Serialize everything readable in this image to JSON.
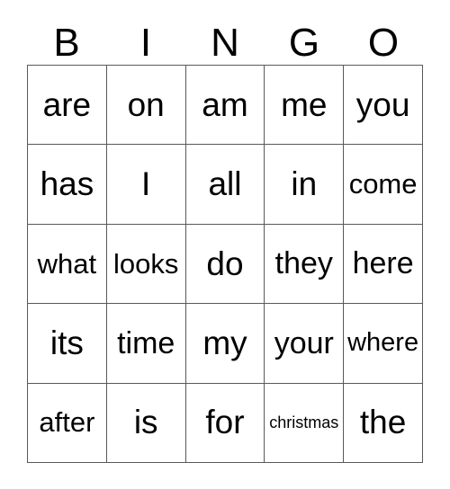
{
  "card": {
    "type": "bingo-card",
    "columns": 5,
    "rows": 5,
    "background_color": "#ffffff",
    "text_color": "#000000",
    "border_color": "#595959"
  },
  "header": {
    "letters": [
      {
        "label": "B"
      },
      {
        "label": "I"
      },
      {
        "label": "N"
      },
      {
        "label": "G"
      },
      {
        "label": "O"
      }
    ]
  },
  "grid": {
    "rows": [
      {
        "cells": [
          {
            "word": "are",
            "size": "fs-xl"
          },
          {
            "word": "on",
            "size": "fs-xl"
          },
          {
            "word": "am",
            "size": "fs-xl"
          },
          {
            "word": "me",
            "size": "fs-xl"
          },
          {
            "word": "you",
            "size": "fs-xl"
          }
        ]
      },
      {
        "cells": [
          {
            "word": "has",
            "size": "fs-xl"
          },
          {
            "word": "I",
            "size": "fs-xl"
          },
          {
            "word": "all",
            "size": "fs-xl"
          },
          {
            "word": "in",
            "size": "fs-xl"
          },
          {
            "word": "come",
            "size": "fs-md"
          }
        ]
      },
      {
        "cells": [
          {
            "word": "what",
            "size": "fs-md"
          },
          {
            "word": "looks",
            "size": "fs-md"
          },
          {
            "word": "do",
            "size": "fs-xl"
          },
          {
            "word": "they",
            "size": "fs-lg"
          },
          {
            "word": "here",
            "size": "fs-lg"
          }
        ]
      },
      {
        "cells": [
          {
            "word": "its",
            "size": "fs-xl"
          },
          {
            "word": "time",
            "size": "fs-lg"
          },
          {
            "word": "my",
            "size": "fs-xl"
          },
          {
            "word": "your",
            "size": "fs-lg"
          },
          {
            "word": "where",
            "size": "fs-sm"
          }
        ]
      },
      {
        "cells": [
          {
            "word": "after",
            "size": "fs-md"
          },
          {
            "word": "is",
            "size": "fs-xl"
          },
          {
            "word": "for",
            "size": "fs-xl"
          },
          {
            "word": "christmas",
            "size": "fs-xs"
          },
          {
            "word": "the",
            "size": "fs-xl"
          }
        ]
      }
    ]
  }
}
